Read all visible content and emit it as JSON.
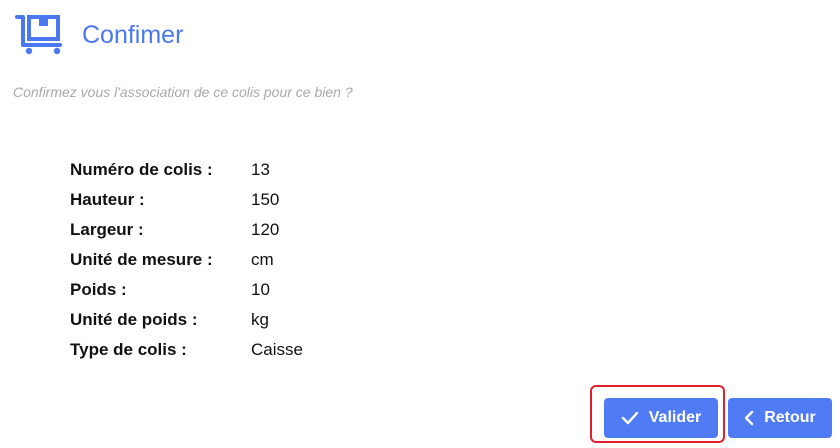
{
  "header": {
    "icon": "package-cart-icon",
    "title": "Confimer"
  },
  "subtitle": "Confirmez vous l'association de ce colis pour ce bien ?",
  "details": [
    {
      "label": "Numéro de colis :",
      "value": "13"
    },
    {
      "label": "Hauteur :",
      "value": "150"
    },
    {
      "label": "Largeur :",
      "value": "120"
    },
    {
      "label": "Unité de mesure :",
      "value": "cm"
    },
    {
      "label": "Poids :",
      "value": "10"
    },
    {
      "label": "Unité de poids :",
      "value": "kg"
    },
    {
      "label": "Type de colis :",
      "value": "Caisse"
    }
  ],
  "actions": {
    "validate_label": "Valider",
    "validate_icon": "check-icon",
    "back_label": "Retour",
    "back_icon": "chevron-left-icon"
  },
  "colors": {
    "accent": "#4a78f0",
    "button": "#4f7cf5",
    "highlight": "#e0202a",
    "subtitle": "#a9a9a9"
  }
}
